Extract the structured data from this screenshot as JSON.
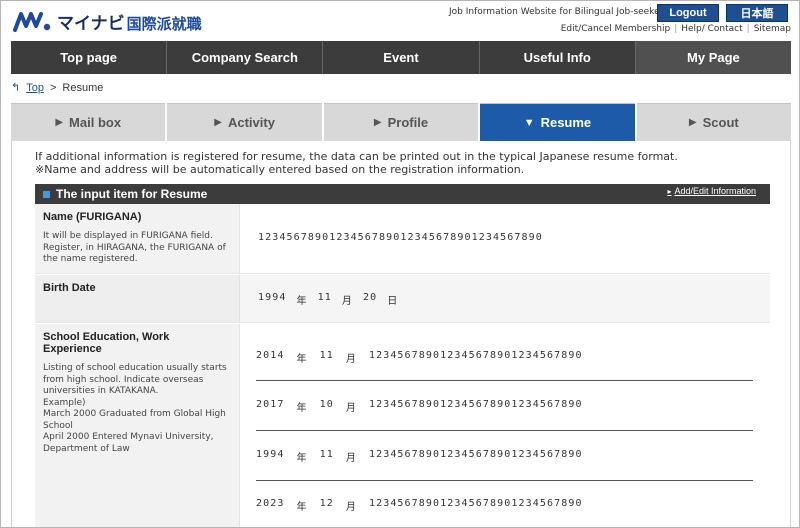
{
  "header": {
    "logo_text": "マイナビ",
    "logo_sub": "国際派就職",
    "tagline": "Job Information Website for Bilingual Job-seekers",
    "logout": "Logout",
    "language": "日本語",
    "links": [
      "Edit/Cancel Membership",
      "Help/ Contact",
      "Sitemap"
    ],
    "separator": "|"
  },
  "nav": [
    "Top page",
    "Company Search",
    "Event",
    "Useful Info",
    "My Page"
  ],
  "breadcrumb": {
    "top": "Top",
    "sep": ">",
    "current": "Resume"
  },
  "tabs": [
    {
      "label": "Mail box",
      "active": false
    },
    {
      "label": "Activity",
      "active": false
    },
    {
      "label": "Profile",
      "active": false
    },
    {
      "label": "Resume",
      "active": true
    },
    {
      "label": "Scout",
      "active": false
    }
  ],
  "intro": {
    "line1": "If additional information is registered for resume, the data can be printed out in the typical Japanese resume format.",
    "line2": "※Name and address will be automatically entered based on the registration information."
  },
  "section": {
    "title": "The input item for Resume",
    "edit_link": "Add/Edit Information"
  },
  "fields": {
    "name": {
      "label": "Name (FURIGANA)",
      "desc": "It will be displayed in FURIGANA field. Register, in HIRAGANA, the FURIGANA of the name registered.",
      "value": "1234567890123456789012345678901234567890"
    },
    "birth": {
      "label": "Birth Date",
      "year": "1994",
      "year_unit": "年",
      "month": "11",
      "month_unit": "月",
      "day": "20",
      "day_unit": "日"
    },
    "education": {
      "label": "School Education, Work Experience",
      "desc_lines": [
        "Listing of school education usually starts from high school. Indicate overseas universities in KATAKANA.",
        "Example)",
        "March 2000 Graduated from Global High School",
        "April 2000 Entered Mynavi University, Department of Law"
      ],
      "entries": [
        {
          "year": "2014",
          "month": "11",
          "text": "123456789012345678901234567890"
        },
        {
          "year": "2017",
          "month": "10",
          "text": "123456789012345678901234567890"
        },
        {
          "year": "1994",
          "month": "11",
          "text": "123456789012345678901234567890"
        },
        {
          "year": "2023",
          "month": "12",
          "text": "123456789012345678901234567890"
        }
      ],
      "year_unit": "年",
      "month_unit": "月"
    }
  },
  "colors": {
    "accent": "#1d5aa8",
    "nav_bg": "#3c3c3c",
    "button": "#1d4f91"
  }
}
